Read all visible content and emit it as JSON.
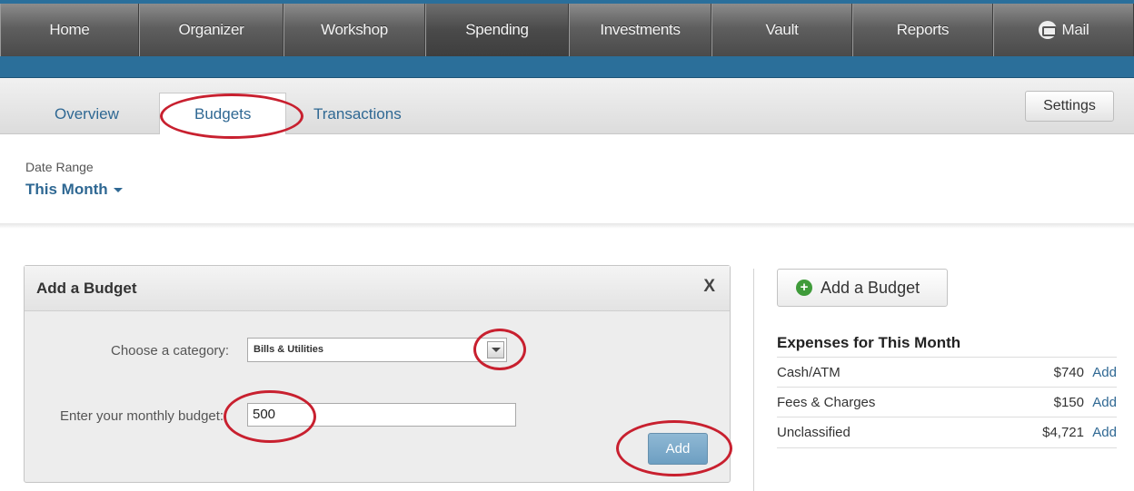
{
  "topnav": {
    "items": [
      {
        "label": "Home"
      },
      {
        "label": "Organizer"
      },
      {
        "label": "Workshop"
      },
      {
        "label": "Spending"
      },
      {
        "label": "Investments"
      },
      {
        "label": "Vault"
      },
      {
        "label": "Reports"
      },
      {
        "label": "Mail",
        "icon": "mail-icon"
      }
    ],
    "active": "Spending"
  },
  "subnav": {
    "tabs": [
      {
        "label": "Overview"
      },
      {
        "label": "Budgets"
      },
      {
        "label": "Transactions"
      }
    ],
    "active": "Budgets",
    "settings_label": "Settings"
  },
  "date_range": {
    "label": "Date Range",
    "value": "This Month"
  },
  "add_budget_panel": {
    "title": "Add a Budget",
    "close_label": "X",
    "category_label": "Choose a category:",
    "category_value": "Bills & Utilities",
    "budget_label": "Enter your monthly budget:",
    "budget_value": "500",
    "add_label": "Add"
  },
  "sidebar": {
    "add_budget_label": "Add a Budget",
    "expenses_title": "Expenses for This Month",
    "rows": [
      {
        "name": "Cash/ATM",
        "amount": "$740",
        "action": "Add"
      },
      {
        "name": "Fees & Charges",
        "amount": "$150",
        "action": "Add"
      },
      {
        "name": "Unclassified",
        "amount": "$4,721",
        "action": "Add"
      }
    ]
  },
  "colors": {
    "brand_blue": "#2b6f9a",
    "link_blue": "#2f6893",
    "highlight_red": "#c8202f",
    "plus_green": "#3f9b3a"
  }
}
